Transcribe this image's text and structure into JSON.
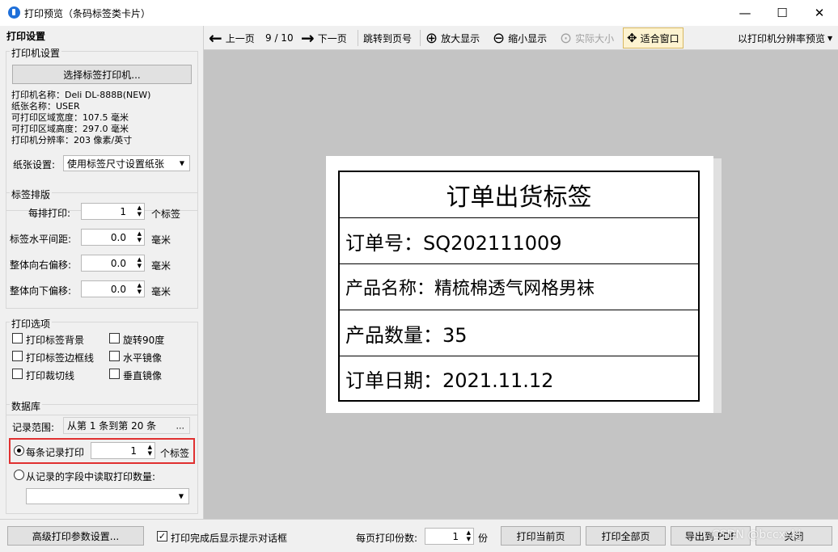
{
  "window": {
    "title": "打印预览（条码标签类卡片）",
    "minimize": "—",
    "maximize": "☐",
    "close": "✕"
  },
  "left_panel": {
    "header": "打印设置",
    "printer_group": {
      "title": "打印机设置",
      "select_button": "选择标签打印机...",
      "printer_name": "打印机名称：Deli DL-888B(NEW)",
      "paper_name": "纸张名称：USER",
      "print_width": "可打印区域宽度：107.5 毫米",
      "print_height": "可打印区域高度：297.0 毫米",
      "resolution": "打印机分辨率：203 像素/英寸",
      "paper_setting_label": "纸张设置:",
      "paper_setting_value": "使用标签尺寸设置纸张"
    },
    "layout_group": {
      "title": "标签排版",
      "per_row_label": "每排打印:",
      "per_row_value": "1",
      "per_row_unit": "个标签",
      "h_spacing_label": "标签水平间距:",
      "h_spacing_value": "0.0",
      "h_spacing_unit": "毫米",
      "right_offset_label": "整体向右偏移:",
      "right_offset_value": "0.0",
      "right_offset_unit": "毫米",
      "down_offset_label": "整体向下偏移:",
      "down_offset_value": "0.0",
      "down_offset_unit": "毫米"
    },
    "options_group": {
      "title": "打印选项",
      "print_background": "打印标签背景",
      "rotate90": "旋转90度",
      "print_border": "打印标签边框线",
      "h_mirror": "水平镜像",
      "print_cutline": "打印裁切线",
      "v_mirror": "垂直镜像"
    },
    "database_group": {
      "title": "数据库",
      "range_label": "记录范围:",
      "range_value": "从第 1 条到第 20 条",
      "range_more": "...",
      "per_record_label": "每条记录打印",
      "per_record_value": "1",
      "per_record_unit": "个标签",
      "from_field_label": "从记录的字段中读取打印数量:"
    }
  },
  "toolbar": {
    "prev": "上一页",
    "page": "9 / 10",
    "next": "下一页",
    "goto": "跳转到页号",
    "zoom_in": "放大显示",
    "zoom_out": "缩小显示",
    "actual": "实际大小",
    "fit": "适合窗口",
    "resolution_preview": "以打印机分辨率预览"
  },
  "label": {
    "title": "订单出货标签",
    "order_no": "订单号：SQ202111009",
    "product_name": "产品名称：精梳棉透气网格男袜",
    "quantity": "产品数量：35",
    "order_date": "订单日期：2021.11.12"
  },
  "bottom": {
    "advanced": "高级打印参数设置...",
    "show_dialog": "打印完成后显示提示对话框",
    "copies_label": "每页打印份数:",
    "copies_value": "1",
    "copies_unit": "份",
    "print_current": "打印当前页",
    "print_all": "打印全部页",
    "export_pdf": "导出到 PDF",
    "close": "关闭",
    "watermark": "CSDN @bccxskj"
  }
}
